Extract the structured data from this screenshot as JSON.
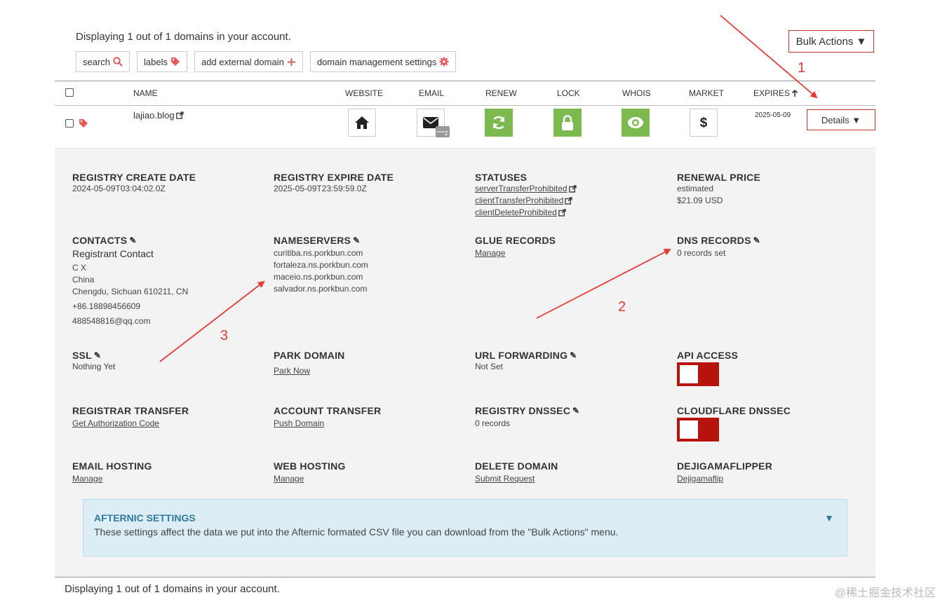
{
  "header": {
    "displaying": "Displaying 1 out of 1 domains in your account.",
    "bulk_actions": "Bulk Actions ▼",
    "toolbar": [
      {
        "label": "search",
        "icon": "search-icon"
      },
      {
        "label": "labels",
        "icon": "tag-icon"
      },
      {
        "label": "add external domain",
        "icon": "plus-icon"
      },
      {
        "label": "domain management settings",
        "icon": "gear-icon"
      }
    ]
  },
  "columns": {
    "name": "NAME",
    "website": "WEBSITE",
    "email": "EMAIL",
    "renew": "RENEW",
    "lock": "LOCK",
    "whois": "WHOIS",
    "market": "MARKET",
    "expires": "EXPIRES"
  },
  "domain_row": {
    "domain": "lajiao.blog",
    "expires": "2025-05-09",
    "details": "Details ▼"
  },
  "details": {
    "registry_create": {
      "title": "REGISTRY CREATE DATE",
      "value": "2024-05-09T03:04:02.0Z"
    },
    "registry_expire": {
      "title": "REGISTRY EXPIRE DATE",
      "value": "2025-05-09T23:59:59.0Z"
    },
    "statuses": {
      "title": "STATUSES",
      "items": [
        "serverTransferProhibited",
        "clientTransferProhibited",
        "clientDeleteProhibited"
      ]
    },
    "renewal_price": {
      "title": "RENEWAL PRICE",
      "line1": "estimated",
      "line2": "$21.09 USD"
    },
    "contacts": {
      "title": "CONTACTS",
      "subtitle": "Registrant Contact",
      "name": "C X",
      "country": "China",
      "city": "Chengdu, Sichuan 610211, CN",
      "phone": "+86.18898456609",
      "email": "488548816@qq.com"
    },
    "nameservers": {
      "title": "NAMESERVERS",
      "items": [
        "curitiba.ns.porkbun.com",
        "fortaleza.ns.porkbun.com",
        "maceio.ns.porkbun.com",
        "salvador.ns.porkbun.com"
      ]
    },
    "glue_records": {
      "title": "GLUE RECORDS",
      "link": "Manage"
    },
    "dns_records": {
      "title": "DNS RECORDS",
      "value": "0 records set"
    },
    "ssl": {
      "title": "SSL",
      "value": "Nothing Yet"
    },
    "park_domain": {
      "title": "PARK DOMAIN",
      "link": "Park Now"
    },
    "url_forwarding": {
      "title": "URL FORWARDING",
      "value": "Not Set"
    },
    "api_access": {
      "title": "API ACCESS",
      "enabled": false
    },
    "registrar_transfer": {
      "title": "REGISTRAR TRANSFER",
      "link": "Get Authorization Code"
    },
    "account_transfer": {
      "title": "ACCOUNT TRANSFER",
      "link": "Push Domain"
    },
    "registry_dnssec": {
      "title": "REGISTRY DNSSEC",
      "value": "0 records"
    },
    "cloudflare_dnssec": {
      "title": "CLOUDFLARE DNSSEC",
      "enabled": false
    },
    "email_hosting": {
      "title": "EMAIL HOSTING",
      "link": "Manage"
    },
    "web_hosting": {
      "title": "WEB HOSTING",
      "link": "Manage"
    },
    "delete_domain": {
      "title": "DELETE DOMAIN",
      "link": "Submit Request"
    },
    "dejigamaflipper": {
      "title": "DEJIGAMAFLIPPER",
      "link": "Dejigamaflip"
    }
  },
  "afternic": {
    "title": "AFTERNIC SETTINGS",
    "description": "These settings affect the data we put into the Afternic formated CSV file you can download from the \"Bulk Actions\" menu."
  },
  "footer": {
    "displaying": "Displaying 1 out of 1 domains in your account.",
    "watermark": "@稀土掘金技术社区"
  },
  "annotations": {
    "one": "1",
    "two": "2",
    "three": "3"
  },
  "colors": {
    "accent": "#c0392b",
    "green": "#7cb94e",
    "toggle": "#b8120c",
    "info_bg": "#dcedf6"
  }
}
